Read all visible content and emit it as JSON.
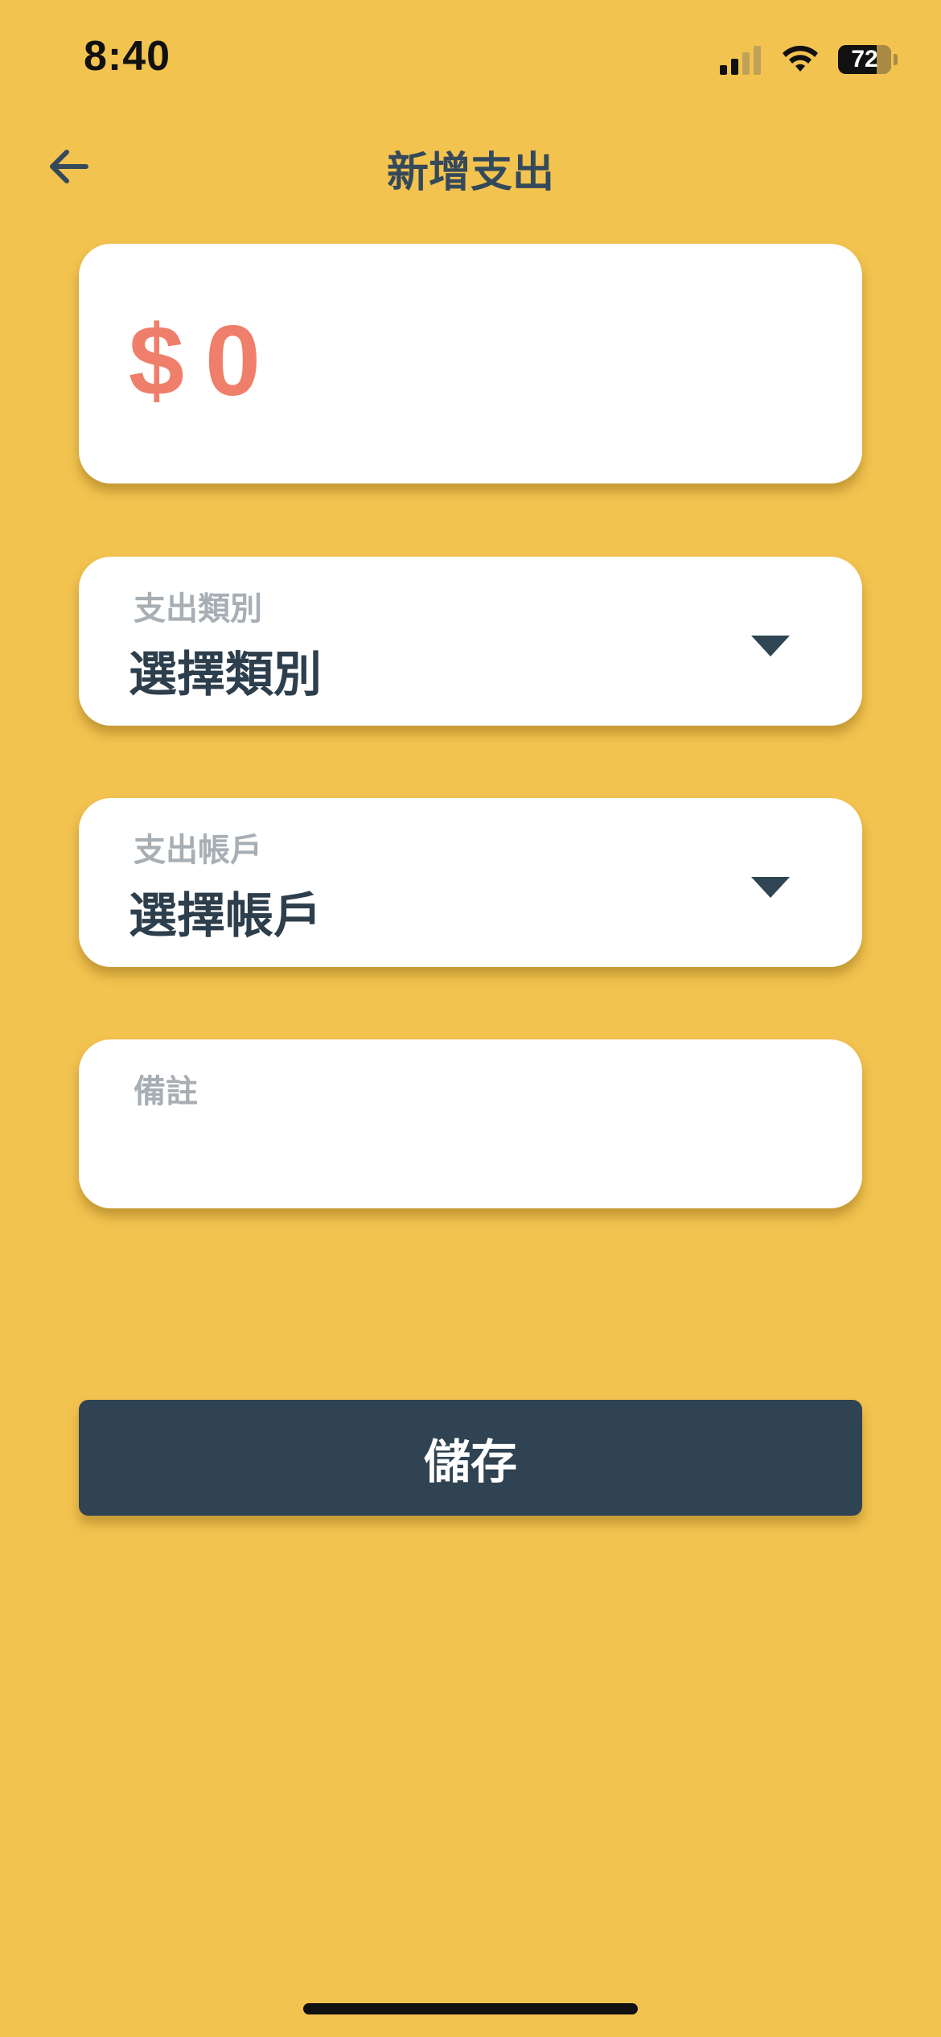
{
  "status_bar": {
    "time": "8:40",
    "battery_percent": "72",
    "battery_level": 0.72,
    "signal_bars_active": 2,
    "signal_bars_total": 4,
    "icons": [
      "signal-icon",
      "wifi-icon",
      "battery-icon"
    ]
  },
  "nav": {
    "back_icon": "arrow-left-icon",
    "title": "新增支出"
  },
  "amount": {
    "currency": "$",
    "value": "0",
    "color": "#EF7F6B"
  },
  "form": {
    "category": {
      "label": "支出類別",
      "value": "選擇類別",
      "icon": "caret-down-icon"
    },
    "account": {
      "label": "支出帳戶",
      "value": "選擇帳戶",
      "icon": "caret-down-icon"
    },
    "note": {
      "label": "備註",
      "value": "",
      "placeholder": ""
    }
  },
  "actions": {
    "save_label": "儲存"
  },
  "theme": {
    "background": "#F3C350",
    "primary_dark": "#2F4352",
    "card": "#FFFFFF",
    "label_gray": "#A7AEB4"
  }
}
